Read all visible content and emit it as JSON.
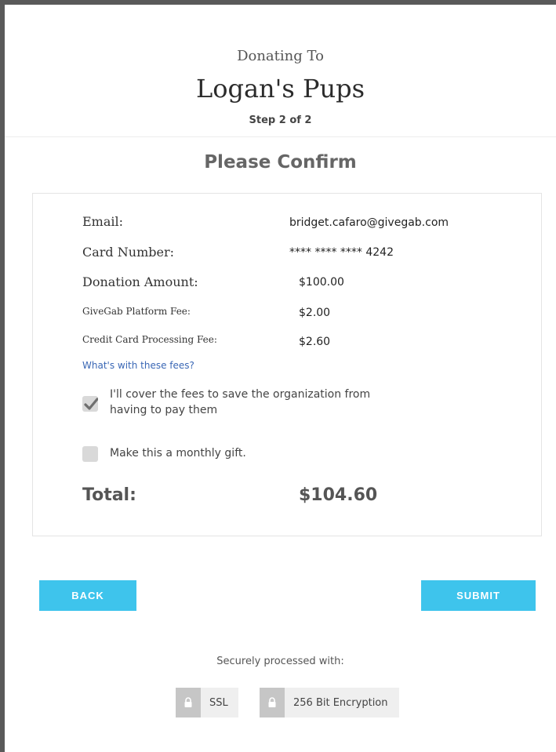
{
  "header": {
    "donating_to": "Donating To",
    "org_name": "Logan's Pups",
    "step": "Step 2 of 2"
  },
  "confirm": {
    "title": "Please Confirm",
    "rows": [
      {
        "label": "Email:",
        "value": "bridget.cafaro@givegab.com"
      },
      {
        "label": "Card Number:",
        "value": "**** **** **** 4242"
      },
      {
        "label": "Donation Amount:",
        "value": "$100.00"
      },
      {
        "label": "GiveGab Platform Fee:",
        "value": "$2.00"
      },
      {
        "label": "Credit Card Processing Fee:",
        "value": "$2.60"
      }
    ],
    "fees_link": "What's with these fees?",
    "cover_fees_line1": "I'll cover the fees to save the organization from",
    "cover_fees_line2": "having to pay them",
    "cover_fees_checked": true,
    "monthly_label": "Make this a monthly gift.",
    "monthly_checked": false,
    "total_label": "Total:",
    "total_value": "$104.60"
  },
  "actions": {
    "back_label": "BACK",
    "submit_label": "SUBMIT"
  },
  "security": {
    "text": "Securely processed with:",
    "badges": [
      {
        "icon": "lock-icon",
        "label": "SSL"
      },
      {
        "icon": "lock-icon",
        "label": "256 Bit Encryption"
      }
    ]
  },
  "colors": {
    "accent": "#3ec4ec",
    "link": "#3a67b5",
    "checkbox": "#d9d9d9"
  }
}
